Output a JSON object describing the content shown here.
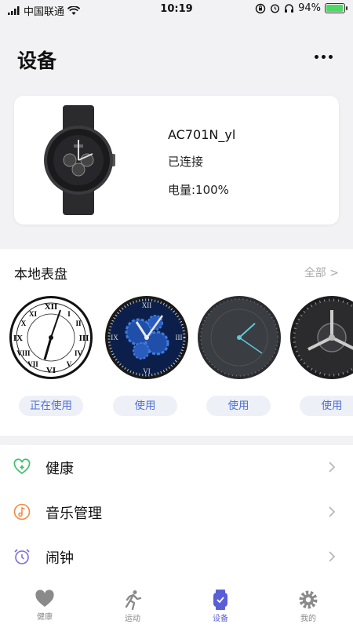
{
  "status_bar": {
    "carrier": "中国联通",
    "time": "10:19",
    "battery_percent": "94%",
    "battery_level": 0.94
  },
  "header": {
    "title": "设备",
    "more_icon": "more-horizontal-icon"
  },
  "device": {
    "name": "AC701N_yl",
    "status": "已连接",
    "battery": "电量:100%"
  },
  "faces": {
    "title": "本地表盘",
    "all_link": "全部 >",
    "items": [
      {
        "style": "roman-white",
        "button": "正在使用"
      },
      {
        "style": "blue-gears",
        "button": "使用"
      },
      {
        "style": "dark-minimal",
        "button": "使用"
      },
      {
        "style": "dark-arrow",
        "button": "使用"
      }
    ]
  },
  "menu": {
    "items": [
      {
        "label": "健康",
        "icon": "heart-plus-icon",
        "color": "#3ec26a"
      },
      {
        "label": "音乐管理",
        "icon": "music-note-icon",
        "color": "#f28a3c"
      },
      {
        "label": "闹钟",
        "icon": "alarm-clock-icon",
        "color": "#7a6ce0"
      }
    ]
  },
  "tabs": [
    {
      "label": "健康",
      "icon": "heart-icon"
    },
    {
      "label": "运动",
      "icon": "running-icon"
    },
    {
      "label": "设备",
      "icon": "watch-icon",
      "active": true
    },
    {
      "label": "我的",
      "icon": "gear-icon"
    }
  ],
  "colors": {
    "accent": "#5b5fd6",
    "button_text": "#4f72d6",
    "background": "#f2f2f5"
  }
}
